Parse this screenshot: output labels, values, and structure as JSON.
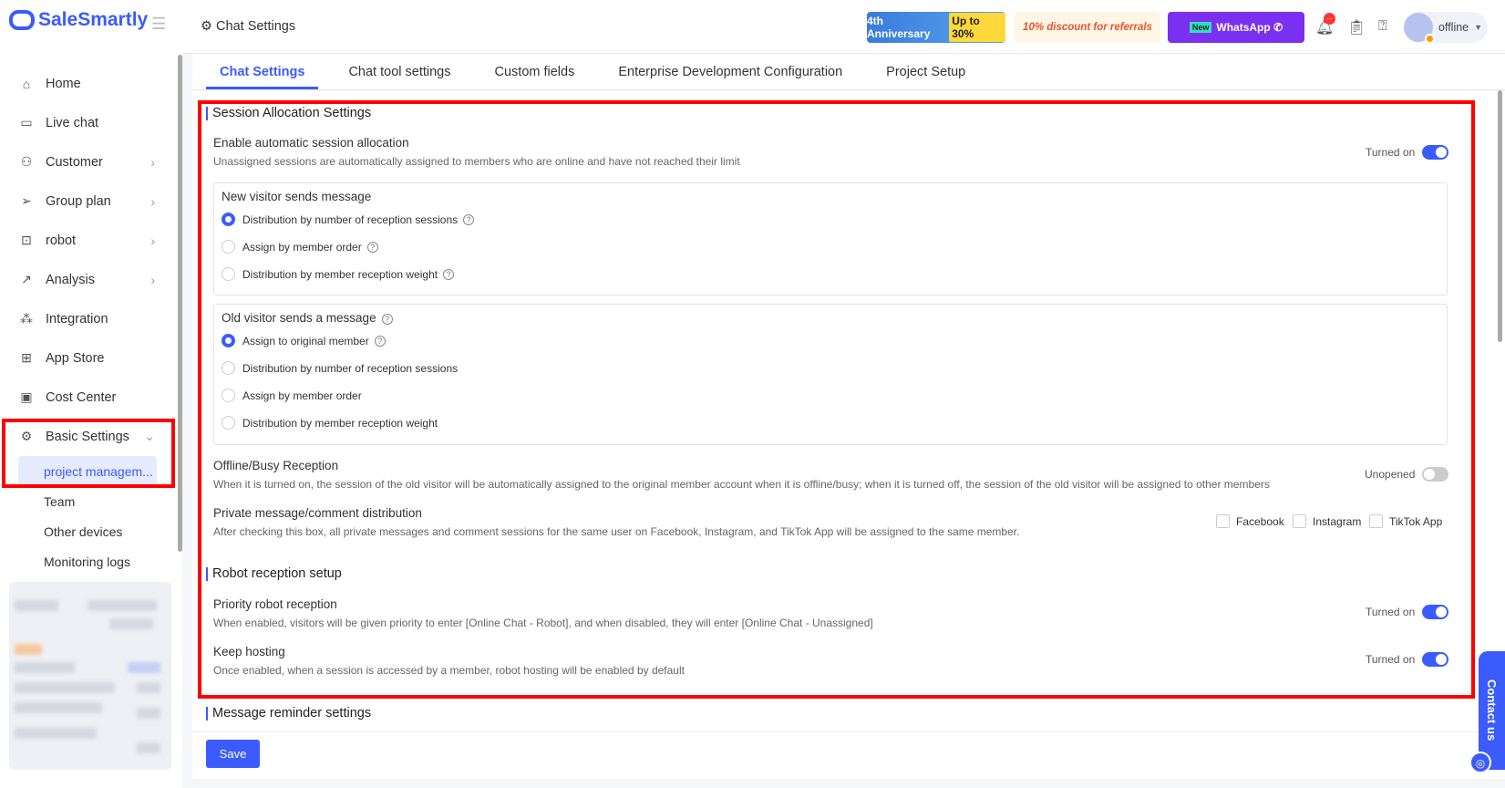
{
  "app": {
    "name": "SaleSmartly"
  },
  "sidebar": {
    "items": [
      {
        "label": "Home",
        "icon": "home-icon"
      },
      {
        "label": "Live chat",
        "icon": "chat-icon"
      },
      {
        "label": "Customer",
        "icon": "users-icon"
      },
      {
        "label": "Group plan",
        "icon": "send-icon"
      },
      {
        "label": "robot",
        "icon": "robot-icon"
      },
      {
        "label": "Analysis",
        "icon": "chart-icon"
      },
      {
        "label": "Integration",
        "icon": "integration-icon"
      },
      {
        "label": "App Store",
        "icon": "grid-icon"
      },
      {
        "label": "Cost Center",
        "icon": "wallet-icon"
      },
      {
        "label": "Basic Settings",
        "icon": "gear-icon"
      }
    ],
    "subitems": [
      "project managem...",
      "Team",
      "Other devices",
      "Monitoring logs"
    ]
  },
  "header": {
    "title": "Chat Settings",
    "banners": [
      "4th Anniversary",
      "Up to 30%",
      "10% discount for referrals",
      "New",
      "WhatsApp"
    ],
    "notification_badge": "...",
    "status": "offline"
  },
  "tabs": [
    "Chat Settings",
    "Chat tool settings",
    "Custom fields",
    "Enterprise Development Configuration",
    "Project Setup"
  ],
  "session": {
    "title": "Session Allocation Settings",
    "auto": {
      "title": "Enable automatic session allocation",
      "desc": "Unassigned sessions are automatically assigned to members who are online and have not reached their limit",
      "state": "Turned on"
    },
    "new_visitor": {
      "title": "New visitor sends message",
      "options": [
        "Distribution by number of reception sessions",
        "Assign by member order",
        "Distribution by member reception weight"
      ],
      "selected": 0
    },
    "old_visitor": {
      "title": "Old visitor sends a message",
      "options": [
        "Assign to original member",
        "Distribution by number of reception sessions",
        "Assign by member order",
        "Distribution by member reception weight"
      ],
      "selected": 0
    },
    "offline": {
      "title": "Offline/Busy Reception",
      "desc": "When it is turned on, the session of the old visitor will be automatically assigned to the original member account when it is offline/busy; when it is turned off, the session of the old visitor will be assigned to other members",
      "state": "Unopened"
    },
    "private": {
      "title": "Private message/comment distribution",
      "desc": "After checking this box, all private messages and comment sessions for the same user on Facebook, Instagram, and TikTok App will be assigned to the same member.",
      "platforms": [
        "Facebook",
        "Instagram",
        "TikTok App"
      ]
    }
  },
  "robot": {
    "title": "Robot reception setup",
    "priority": {
      "title": "Priority robot reception",
      "desc": "When enabled, visitors will be given priority to enter [Online Chat - Robot], and when disabled, they will enter [Online Chat - Unassigned]",
      "state": "Turned on"
    },
    "hosting": {
      "title": "Keep hosting",
      "desc": "Once enabled, when a session is accessed by a member, robot hosting will be enabled by default",
      "state": "Turned on"
    }
  },
  "reminder": {
    "title": "Message reminder settings"
  },
  "save_label": "Save",
  "contact_label": "Contact us"
}
